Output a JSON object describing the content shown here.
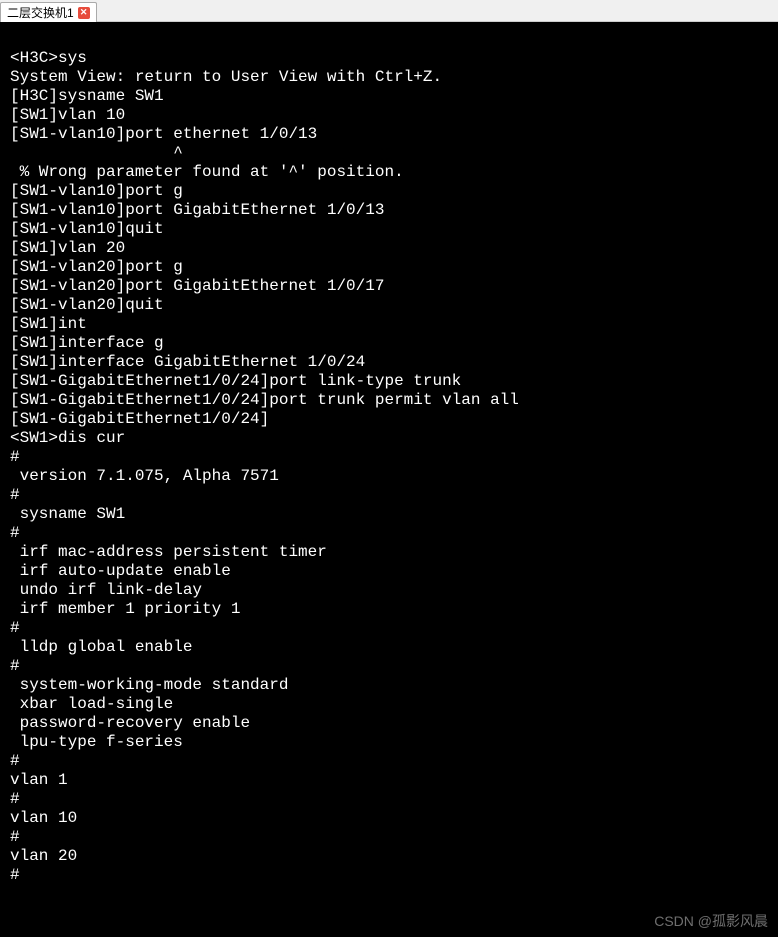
{
  "tab": {
    "title": "二层交换机1",
    "close_glyph": "✕"
  },
  "terminal": {
    "lines": [
      "",
      "<H3C>sys",
      "System View: return to User View with Ctrl+Z.",
      "[H3C]sysname SW1",
      "[SW1]vlan 10",
      "[SW1-vlan10]port ethernet 1/0/13",
      "                 ^",
      " % Wrong parameter found at '^' position.",
      "[SW1-vlan10]port g",
      "[SW1-vlan10]port GigabitEthernet 1/0/13",
      "[SW1-vlan10]quit",
      "[SW1]vlan 20",
      "[SW1-vlan20]port g",
      "[SW1-vlan20]port GigabitEthernet 1/0/17",
      "[SW1-vlan20]quit",
      "[SW1]int",
      "[SW1]interface g",
      "[SW1]interface GigabitEthernet 1/0/24",
      "[SW1-GigabitEthernet1/0/24]port link-type trunk",
      "[SW1-GigabitEthernet1/0/24]port trunk permit vlan all",
      "[SW1-GigabitEthernet1/0/24]",
      "<SW1>dis cur",
      "#",
      " version 7.1.075, Alpha 7571",
      "#",
      " sysname SW1",
      "#",
      " irf mac-address persistent timer",
      " irf auto-update enable",
      " undo irf link-delay",
      " irf member 1 priority 1",
      "#",
      " lldp global enable",
      "#",
      " system-working-mode standard",
      " xbar load-single",
      " password-recovery enable",
      " lpu-type f-series",
      "#",
      "vlan 1",
      "#",
      "vlan 10",
      "#",
      "vlan 20",
      "#"
    ]
  },
  "watermark": "CSDN @孤影风晨"
}
